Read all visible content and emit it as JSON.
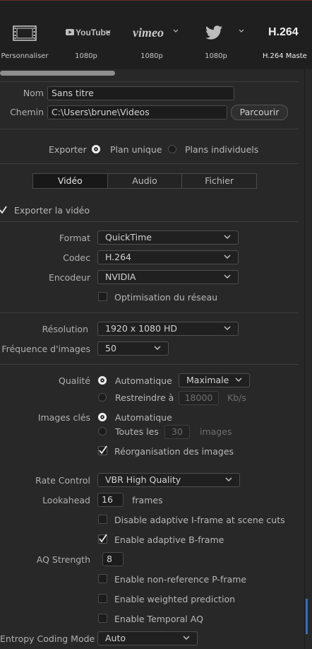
{
  "colors": {
    "accent": "#3070c0",
    "background": "#282828",
    "header_bg": "#1f1f1f"
  },
  "presets": [
    {
      "name": "Personnaliser",
      "icon": "film-icon",
      "sub": "Personnaliser"
    },
    {
      "name": "YouTube",
      "icon": "youtube-icon",
      "sub": "1080p"
    },
    {
      "name": "vimeo",
      "icon": "vimeo-icon",
      "sub": "1080p"
    },
    {
      "name": "Twitter",
      "icon": "twitter-icon",
      "sub": "1080p"
    },
    {
      "name": "H.264",
      "icon": "h264-text",
      "sub": "H.264 Maste"
    }
  ],
  "file": {
    "name_label": "Nom",
    "name_value": "Sans titre",
    "path_label": "Chemin",
    "path_value": "C:\\Users\\brune\\Videos",
    "browse": "Parcourir"
  },
  "export_mode": {
    "label": "Exporter",
    "options": [
      "Plan unique",
      "Plans individuels"
    ],
    "selected": "Plan unique"
  },
  "tabs": [
    "Vidéo",
    "Audio",
    "Fichier"
  ],
  "active_tab": "Vidéo",
  "export_video": {
    "label": "Exporter la vidéo",
    "checked": true
  },
  "video": {
    "format_label": "Format",
    "format_value": "QuickTime",
    "codec_label": "Codec",
    "codec_value": "H.264",
    "encoder_label": "Encodeur",
    "encoder_value": "NVIDIA",
    "network_opt": {
      "label": "Optimisation du réseau",
      "checked": false
    },
    "resolution_label": "Résolution",
    "resolution_value": "1920 x 1080 HD",
    "fps_label": "Fréquence d'images",
    "fps_value": "50"
  },
  "quality": {
    "label": "Qualité",
    "auto_label": "Automatique",
    "auto_selected": true,
    "preset_value": "Maximale",
    "restrict_label": "Restreindre à",
    "restrict_value": "18000",
    "restrict_unit": "Kb/s"
  },
  "keyframes": {
    "label": "Images clés",
    "auto_label": "Automatique",
    "auto_selected": true,
    "every_label": "Toutes les",
    "every_value": "30",
    "every_unit": "images",
    "reorder": {
      "label": "Réorganisation des images",
      "checked": true
    }
  },
  "rate": {
    "label": "Rate Control",
    "value": "VBR High Quality",
    "lookahead_label": "Lookahead",
    "lookahead_value": "16",
    "lookahead_unit": "frames",
    "disable_iframe": {
      "label": "Disable adaptive I-frame at scene cuts",
      "checked": false
    },
    "enable_bframe": {
      "label": "Enable adaptive B-frame",
      "checked": true
    },
    "aq_label": "AQ Strength",
    "aq_value": "8",
    "nonref_p": {
      "label": "Enable non-reference P-frame",
      "checked": false
    },
    "weighted": {
      "label": "Enable weighted prediction",
      "checked": false
    },
    "temporal_aq": {
      "label": "Enable Temporal AQ",
      "checked": false
    },
    "entropy_label": "Entropy Coding Mode",
    "entropy_value": "Auto"
  }
}
